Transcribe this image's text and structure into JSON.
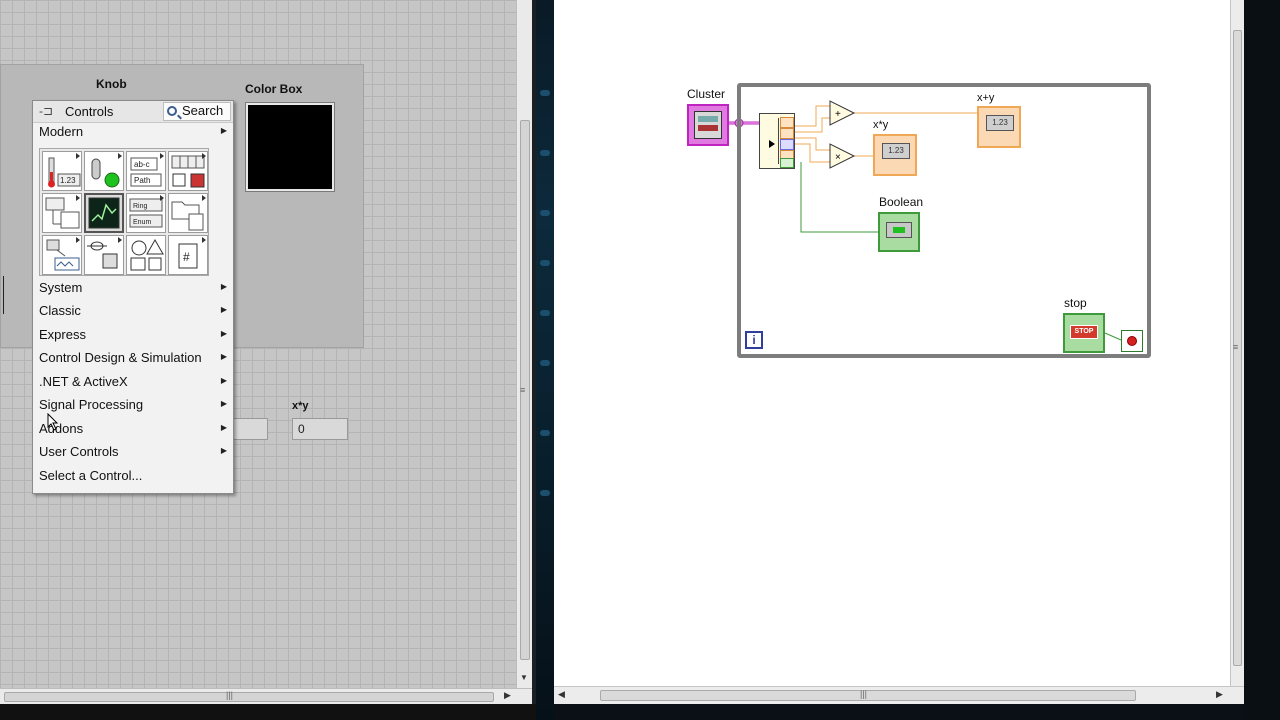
{
  "front_panel": {
    "labels": {
      "knob": "Knob",
      "color_box": "Color Box",
      "xy_product": "x*y"
    },
    "xy_product_value": "0",
    "color_box_color": "#000000"
  },
  "controls_palette": {
    "title": "Controls",
    "search_label": "Search",
    "modern_label": "Modern",
    "categories": [
      "System",
      "Classic",
      "Express",
      "Control Design & Simulation",
      ".NET & ActiveX",
      "Signal Processing",
      "Addons",
      "User Controls"
    ],
    "select_control": "Select a Control...",
    "icons": [
      "numeric-palette-icon",
      "boolean-palette-icon",
      "string-path-palette-icon",
      "array-matrix-cluster-palette-icon",
      "list-table-tree-palette-icon",
      "graph-palette-icon",
      "ring-enum-palette-icon",
      "containers-palette-icon",
      "io-palette-icon",
      "variant-class-palette-icon",
      "decorations-palette-icon",
      "refnum-palette-icon"
    ],
    "icon_text": {
      "numeric": "1.23",
      "string_1": "ab-c",
      "string_2": "Path",
      "ring": "Ring",
      "enum": "Enum"
    }
  },
  "block_diagram": {
    "labels": {
      "cluster": "Cluster",
      "x_times_y": "x*y",
      "x_plus_y": "x+y",
      "boolean": "Boolean",
      "stop": "stop"
    },
    "numeric_display": "1.23",
    "stop_button_text": "STOP",
    "iteration_terminal": "i",
    "colors": {
      "cluster_wire": "#c020c0",
      "numeric_wire": "#f0a856",
      "boolean_wire": "#3e9a3a",
      "loop_border": "#7d7d7d"
    }
  }
}
